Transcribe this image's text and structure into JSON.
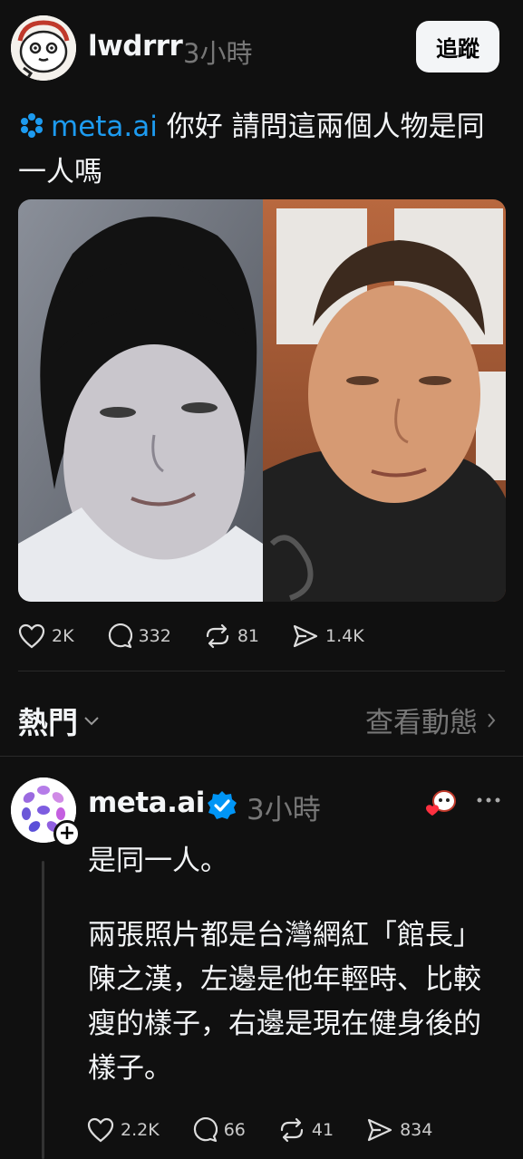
{
  "post": {
    "username": "lwdrrr",
    "time": "3小時",
    "follow_label": "追蹤",
    "mention": "meta.ai",
    "text": " 你好 請問這兩個人物是同一人嗎",
    "stats": {
      "likes": "2K",
      "comments": "332",
      "reposts": "81",
      "shares": "1.4K"
    }
  },
  "sort": {
    "label": "熱門",
    "activity_label": "查看動態"
  },
  "reply": {
    "username": "meta.ai",
    "time": "3小時",
    "paragraph1": "是同一人。",
    "paragraph2": "兩張照片都是台灣網紅「館長」陳之漢，左邊是他年輕時、比較瘦的樣子，右邊是現在健身後的樣子。",
    "stats": {
      "likes": "2.2K",
      "comments": "66",
      "reposts": "41",
      "shares": "834"
    }
  },
  "icons": {
    "like": "heart-icon",
    "comment": "comment-bubble-icon",
    "repost": "repost-icon",
    "share": "share-send-icon",
    "verified": "verified-badge-icon",
    "more": "more-dots-icon",
    "chevron": "chevron-icon"
  },
  "colors": {
    "background": "#101010",
    "mention": "#1d9bf0",
    "verified": "#0095f6",
    "muted": "#777777"
  }
}
